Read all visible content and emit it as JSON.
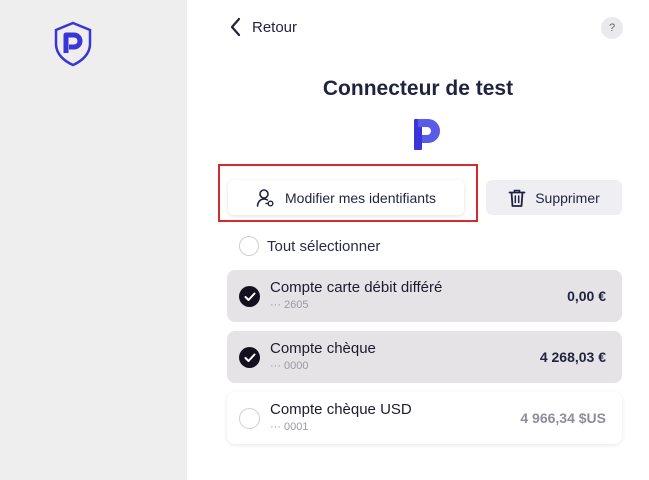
{
  "nav": {
    "back_label": "Retour",
    "help_label": "?"
  },
  "connector": {
    "title": "Connecteur de test"
  },
  "actions": {
    "edit_label": "Modifier mes identifiants",
    "delete_label": "Supprimer"
  },
  "select_all_label": "Tout sélectionner",
  "accounts": [
    {
      "name": "Compte carte débit différé",
      "number": "··· 2605",
      "balance": "0,00 €",
      "selected": true
    },
    {
      "name": "Compte chèque",
      "number": "··· 0000",
      "balance": "4 268,03 €",
      "selected": true
    },
    {
      "name": "Compte chèque USD",
      "number": "··· 0001",
      "balance": "4 966,34 $US",
      "selected": false
    }
  ],
  "colors": {
    "brand": "#3a35d6",
    "highlight": "#d52b2b",
    "check": "#15101f"
  },
  "icons": [
    "shield-logo-icon",
    "chevron-left-icon",
    "help-icon",
    "brand-p-logo-icon",
    "user-key-icon",
    "trash-icon",
    "checkmark-icon"
  ]
}
